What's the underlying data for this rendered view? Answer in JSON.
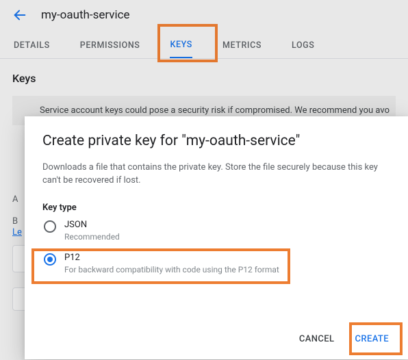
{
  "header": {
    "title": "my-oauth-service"
  },
  "tabs": {
    "details": "DETAILS",
    "permissions": "PERMISSIONS",
    "keys": "KEYS",
    "metrics": "METRICS",
    "logs": "LOGS",
    "active_index": 2
  },
  "keys_section": {
    "heading": "Keys",
    "warning": "Service account keys could pose a security risk if compromised. We recommend you avo",
    "partial_link": "Le"
  },
  "dialog": {
    "title": "Create private key for \"my-oauth-service\"",
    "description": "Downloads a file that contains the private key. Store the file securely because this key can't be recovered if lost.",
    "keytype_label": "Key type",
    "options": {
      "json": {
        "label": "JSON",
        "sub": "Recommended",
        "selected": false
      },
      "p12": {
        "label": "P12",
        "sub": "For backward compatibility with code using the P12 format",
        "selected": true
      }
    },
    "actions": {
      "cancel": "CANCEL",
      "create": "CREATE"
    }
  }
}
